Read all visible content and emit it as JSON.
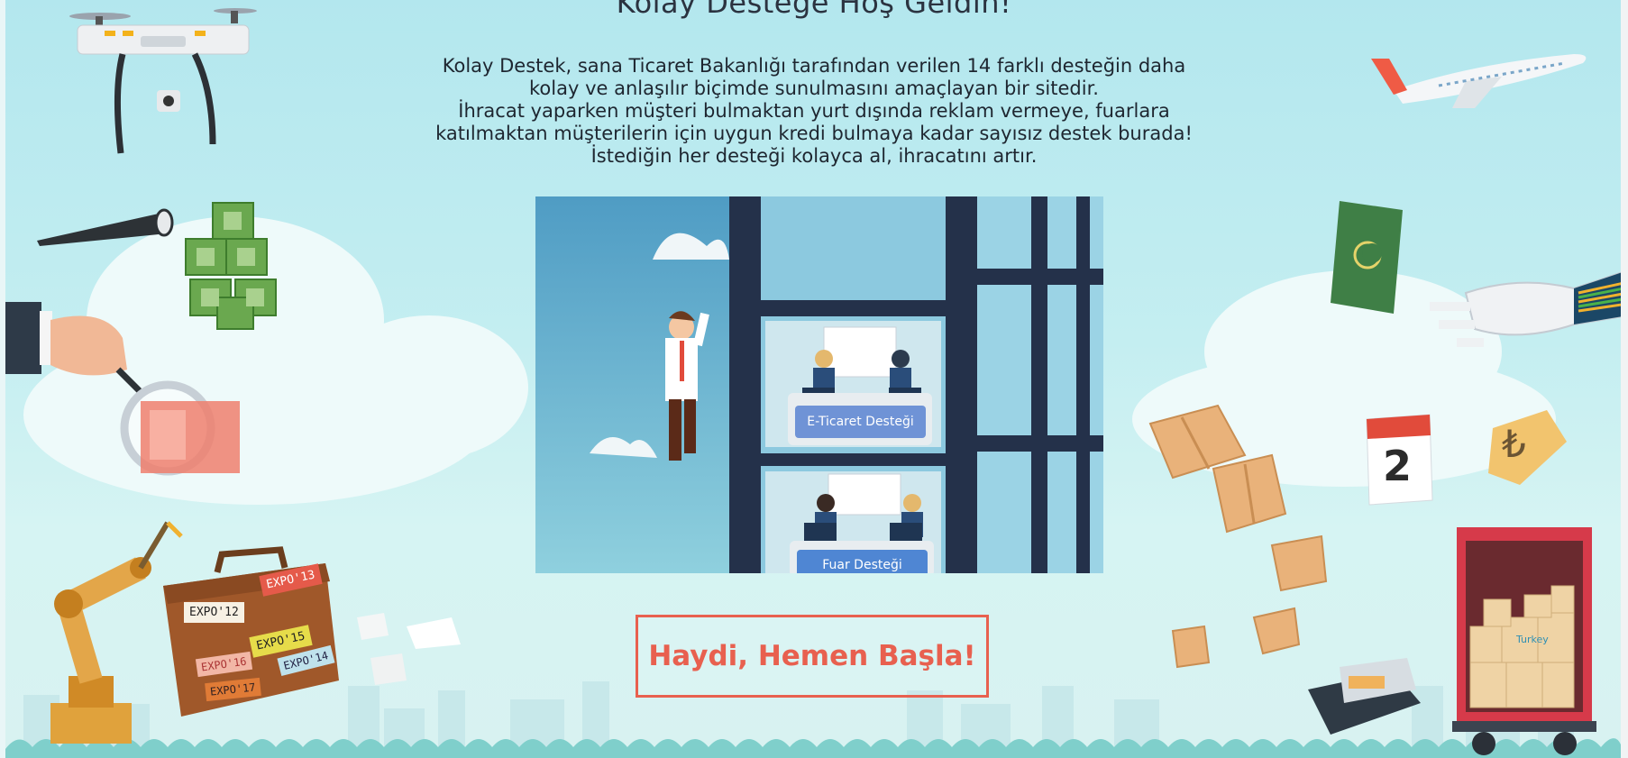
{
  "header": {
    "title": "Kolay Desteğe Hoş Geldin!"
  },
  "intro": {
    "line1": "Kolay Destek, sana Ticaret Bakanlığı tarafından verilen 14 farklı desteğin daha kolay ve anlaşılır biçimde sunulmasını amaçlayan bir sitedir.",
    "line2": "İhracat yaparken müşteri bulmaktan yurt dışında reklam vermeye, fuarlara katılmaktan müşterilerin için uygun kredi bulmaya kadar sayısız destek burada! İstediğin her desteği kolayca al, ihracatını artır."
  },
  "hero": {
    "card1_label": "E-Ticaret Desteği",
    "card2_label": "Fuar Desteği"
  },
  "cta": {
    "label": "Haydi, Hemen Başla!"
  },
  "decorations": {
    "briefcase_stickers": [
      "EXPO'12",
      "EXPO'13",
      "EXPO'15",
      "EXPO'16",
      "EXPO'14",
      "EXPO'17"
    ],
    "calendar_day": "2",
    "currency_symbol": "₺",
    "box_label": "Turkey"
  },
  "colors": {
    "accent": "#e8604f",
    "sky": "#b3e7ee",
    "dark_text": "#1e2630"
  }
}
